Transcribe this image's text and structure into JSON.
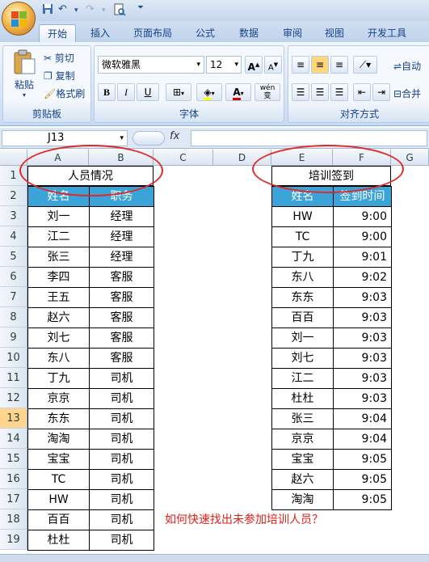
{
  "title_bar": {
    "quick_access": [
      "save-icon",
      "undo-icon",
      "redo-icon",
      "print-preview-icon"
    ]
  },
  "tabs": [
    {
      "label": "开始"
    },
    {
      "label": "插入"
    },
    {
      "label": "页面布局"
    },
    {
      "label": "公式"
    },
    {
      "label": "数据"
    },
    {
      "label": "审阅"
    },
    {
      "label": "视图"
    },
    {
      "label": "开发工具"
    }
  ],
  "ribbon": {
    "clipboard": {
      "paste": "粘贴",
      "cut": "剪切",
      "copy": "复制",
      "format_painter": "格式刷",
      "group_label": "剪贴板"
    },
    "font": {
      "font_name": "微软雅黑",
      "font_size": "12",
      "grow": "A",
      "shrink": "A",
      "bold": "B",
      "italic": "I",
      "underline": "U",
      "font_color_letter": "A",
      "phonetic": "wén 变",
      "group_label": "字体"
    },
    "align": {
      "wrap": "自动",
      "merge": "合并",
      "group_label": "对齐方式"
    }
  },
  "formula_bar": {
    "name_box": "J13",
    "fx": "fx",
    "value": ""
  },
  "columns": [
    "A",
    "B",
    "C",
    "D",
    "E",
    "F",
    "G"
  ],
  "rows": [
    "1",
    "2",
    "3",
    "4",
    "5",
    "6",
    "7",
    "8",
    "9",
    "10",
    "11",
    "12",
    "13",
    "14",
    "15",
    "16",
    "17",
    "18",
    "19"
  ],
  "selected_row": "13",
  "table_left": {
    "title": "人员情况",
    "headers": [
      "姓名",
      "职务"
    ],
    "rows": [
      [
        "刘一",
        "经理"
      ],
      [
        "江二",
        "经理"
      ],
      [
        "张三",
        "经理"
      ],
      [
        "李四",
        "客服"
      ],
      [
        "王五",
        "客服"
      ],
      [
        "赵六",
        "客服"
      ],
      [
        "刘七",
        "客服"
      ],
      [
        "东八",
        "客服"
      ],
      [
        "丁九",
        "司机"
      ],
      [
        "京京",
        "司机"
      ],
      [
        "东东",
        "司机"
      ],
      [
        "淘淘",
        "司机"
      ],
      [
        "宝宝",
        "司机"
      ],
      [
        "TC",
        "司机"
      ],
      [
        "HW",
        "司机"
      ],
      [
        "百百",
        "司机"
      ],
      [
        "杜杜",
        "司机"
      ]
    ]
  },
  "table_right": {
    "title": "培训签到",
    "headers": [
      "姓名",
      "签到时间"
    ],
    "rows": [
      [
        "HW",
        "9:00"
      ],
      [
        "TC",
        "9:00"
      ],
      [
        "丁九",
        "9:01"
      ],
      [
        "东八",
        "9:02"
      ],
      [
        "东东",
        "9:03"
      ],
      [
        "百百",
        "9:03"
      ],
      [
        "刘一",
        "9:03"
      ],
      [
        "刘七",
        "9:03"
      ],
      [
        "江二",
        "9:03"
      ],
      [
        "杜杜",
        "9:03"
      ],
      [
        "张三",
        "9:04"
      ],
      [
        "京京",
        "9:04"
      ],
      [
        "宝宝",
        "9:05"
      ],
      [
        "赵六",
        "9:05"
      ],
      [
        "淘淘",
        "9:05"
      ]
    ]
  },
  "note": "如何快速找出未参加培训人员？",
  "colors": {
    "header_fill": "#3aa4d8",
    "annotation": "#e02a2a"
  }
}
